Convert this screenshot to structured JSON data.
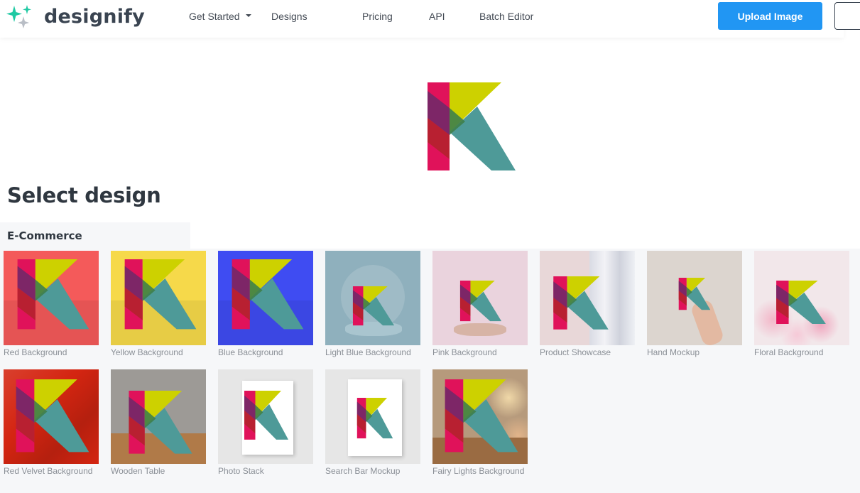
{
  "header": {
    "brand": "designify",
    "nav": [
      {
        "label": "Get Started",
        "has_dropdown": true
      },
      {
        "label": "Designs"
      },
      {
        "label": "Pricing"
      },
      {
        "label": "API"
      },
      {
        "label": "Batch Editor"
      }
    ],
    "upload_label": "Upload Image"
  },
  "section": {
    "title": "Select design",
    "category": "E-Commerce"
  },
  "designs": [
    {
      "label": "Red Background",
      "bg": "#f45a5a"
    },
    {
      "label": "Yellow Background",
      "bg": "#f6d94a"
    },
    {
      "label": "Blue Background",
      "bg": "#3f4cf2"
    },
    {
      "label": "Light Blue Background",
      "bg": "#8fb0bd"
    },
    {
      "label": "Pink Background",
      "bg": "#ead3dd"
    },
    {
      "label": "Product Showcase",
      "bg": "#e8d7d8"
    },
    {
      "label": "Hand Mockup",
      "bg": "#dcd5cf"
    },
    {
      "label": "Floral Background",
      "bg": "#f2e7ea"
    },
    {
      "label": "Red Velvet Background",
      "bg": "#d42511"
    },
    {
      "label": "Wooden Table",
      "bg": "#9d9a96"
    },
    {
      "label": "Photo Stack",
      "bg": "#e6e6e6"
    },
    {
      "label": "Search Bar Mockup",
      "bg": "#e6e6e6"
    },
    {
      "label": "Fairy Lights Background",
      "bg": "#b69a7c"
    }
  ],
  "colors": {
    "accent": "#2196f3",
    "logo_magenta": "#e0125a",
    "logo_lime": "#cdd100",
    "logo_teal": "#4e9a98"
  }
}
